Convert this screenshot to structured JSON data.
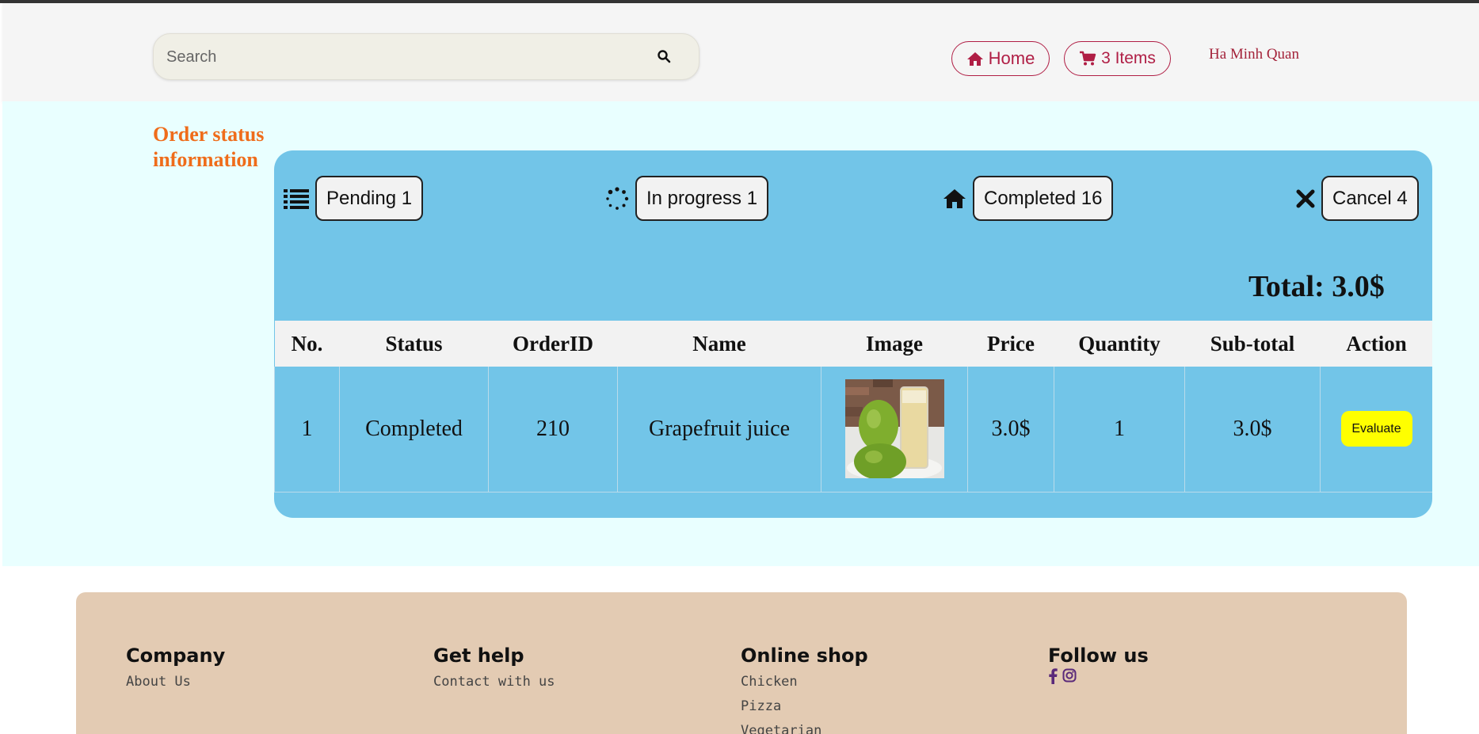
{
  "header": {
    "search_placeholder": "Search",
    "home_label": "Home",
    "cart_label": "3 Items",
    "user_name": "Ha Minh Quan"
  },
  "section_title": "Order status information",
  "status_filters": [
    {
      "label": "Pending 1",
      "icon": "list-icon"
    },
    {
      "label": "In progress 1",
      "icon": "spinner-icon"
    },
    {
      "label": "Completed 16",
      "icon": "home-icon"
    },
    {
      "label": "Cancel 4",
      "icon": "close-icon"
    }
  ],
  "total": "Total: 3.0$",
  "table": {
    "columns": [
      "No.",
      "Status",
      "OrderID",
      "Name",
      "Image",
      "Price",
      "Quantity",
      "Sub-total",
      "Action"
    ],
    "rows": [
      {
        "no": "1",
        "status": "Completed",
        "order_id": "210",
        "name": "Grapefruit juice",
        "image": "grapefruit-juice-photo",
        "price": "3.0$",
        "quantity": "1",
        "subtotal": "3.0$",
        "action": "Evaluate"
      }
    ]
  },
  "footer": {
    "company": {
      "title": "Company",
      "links": [
        "About Us"
      ]
    },
    "help": {
      "title": "Get help",
      "links": [
        "Contact with us"
      ]
    },
    "shop": {
      "title": "Online shop",
      "links": [
        "Chicken",
        "Pizza",
        "Vegetarian"
      ]
    },
    "follow": {
      "title": "Follow us",
      "icons": [
        "facebook-icon",
        "instagram-icon"
      ]
    }
  },
  "colors": {
    "accent": "#b01e45",
    "title_orange": "#ef6c1a",
    "panel_blue": "#72c5e8",
    "evaluate_yellow": "#ffff00",
    "footer_tan": "#e3cbb3"
  }
}
